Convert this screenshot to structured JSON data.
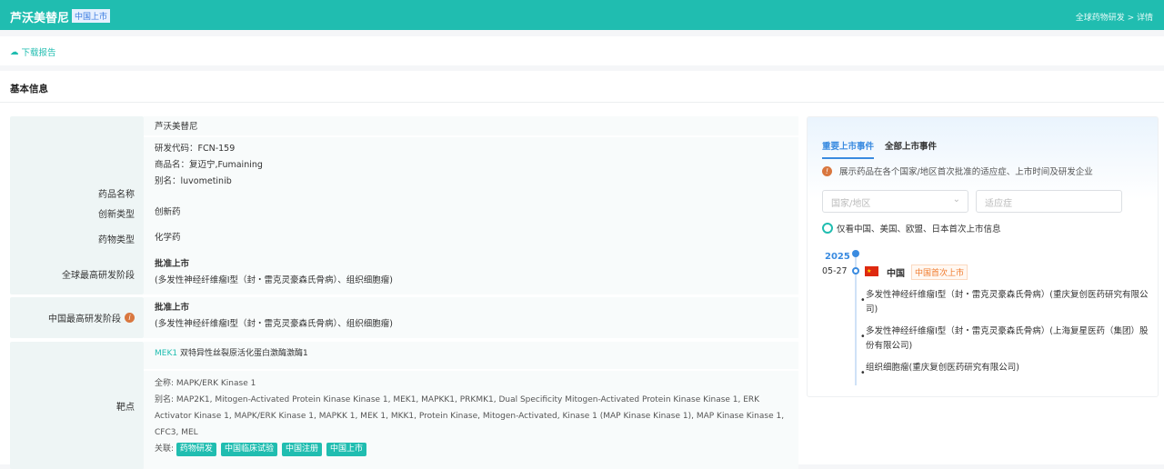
{
  "header": {
    "title": "芦沃美替尼",
    "badge": "中国上市",
    "breadcrumb": "全球药物研发 > 详情"
  },
  "toolbar": {
    "download": "下载报告"
  },
  "section": {
    "title": "基本信息"
  },
  "info": {
    "name_label": "药品名称",
    "name": "芦沃美替尼",
    "code": "研发代码：FCN-159",
    "trade": "商品名：复迈宁,Fumaining",
    "alias": "别名：luvometinib",
    "innov_label": "创新类型",
    "innov": "创新药",
    "type_label": "药物类型",
    "type": "化学药",
    "global_label": "全球最高研发阶段",
    "global_stage": "批准上市",
    "global_ind": "(多发性神经纤维瘤Ⅰ型（封・雷克灵豪森氏骨病）、组织细胞瘤)",
    "china_label": "中国最高研发阶段",
    "china_stage": "批准上市",
    "china_ind": "(多发性神经纤维瘤Ⅰ型（封・雷克灵豪森氏骨病）、组织细胞瘤)",
    "target_label": "靶点",
    "target_code": "MEK1",
    "target_name": "双特异性丝裂原活化蛋白激酶激酶1",
    "fullname": "全称: MAPK/ERK Kinase 1",
    "aliases": "别名: MAP2K1, Mitogen-Activated Protein Kinase Kinase 1, MEK1, MAPKK1, PRKMK1, Dual Specificity Mitogen-Activated Protein Kinase Kinase 1, ERK Activator Kinase 1, MAPK/ERK Kinase 1, MAPKK 1, MEK 1, MKK1, Protein Kinase, Mitogen-Activated, Kinase 1 (MAP Kinase Kinase 1), MAP Kinase Kinase 1, CFC3, MEL",
    "related_label": "关联:",
    "related": [
      "药物研发",
      "中国临床试验",
      "中国注册",
      "中国上市"
    ]
  },
  "events": {
    "tabs": [
      "重要上市事件",
      "全部上市事件"
    ],
    "note": "展示药品在各个国家/地区首次批准的适应症、上市时间及研发企业",
    "country_placeholder": "国家/地区",
    "indication_placeholder": "适应症",
    "filter": "仅看中国、美国、欧盟、日本首次上市信息",
    "year": "2025",
    "date": "05-27",
    "country": "中国",
    "badge": "中国首次上市",
    "items": [
      "多发性神经纤维瘤Ⅰ型（封・雷克灵豪森氏骨病）(重庆复创医药研究有限公司)",
      "多发性神经纤维瘤Ⅰ型（封・雷克灵豪森氏骨病）(上海复星医药（集团）股份有限公司)",
      "组织细胞瘤(重庆复创医药研究有限公司)"
    ]
  }
}
